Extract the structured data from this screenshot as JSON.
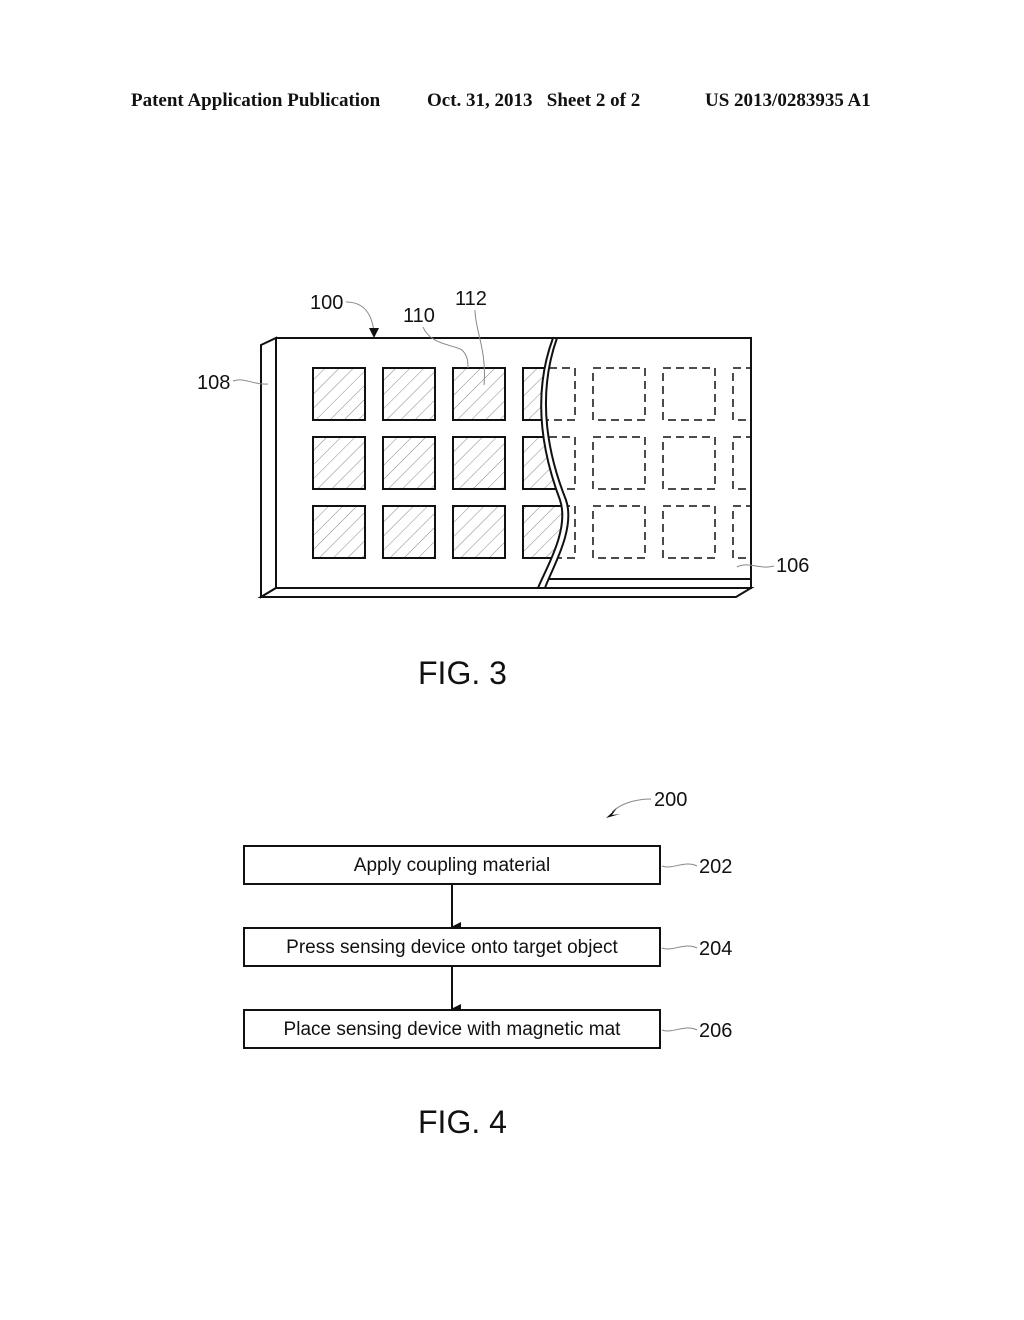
{
  "header": {
    "publication_type": "Patent Application Publication",
    "date_sheet": "Oct. 31, 2013   Sheet 2 of 2",
    "publication_number": "US 2013/0283935 A1"
  },
  "fig3": {
    "caption": "FIG. 3",
    "refs": {
      "device": "100",
      "sensor_element": "110",
      "sensor_pad": "112",
      "side_edge": "108",
      "base_layer": "106"
    },
    "grid": {
      "rows": 3,
      "hatched_columns": 4,
      "dashed_columns": 3
    }
  },
  "fig4": {
    "caption": "FIG. 4",
    "method_ref": "200",
    "steps": [
      {
        "ref": "202",
        "label": "Apply coupling material"
      },
      {
        "ref": "204",
        "label": "Press sensing device onto target object"
      },
      {
        "ref": "206",
        "label": "Place sensing device with magnetic mat"
      }
    ]
  }
}
